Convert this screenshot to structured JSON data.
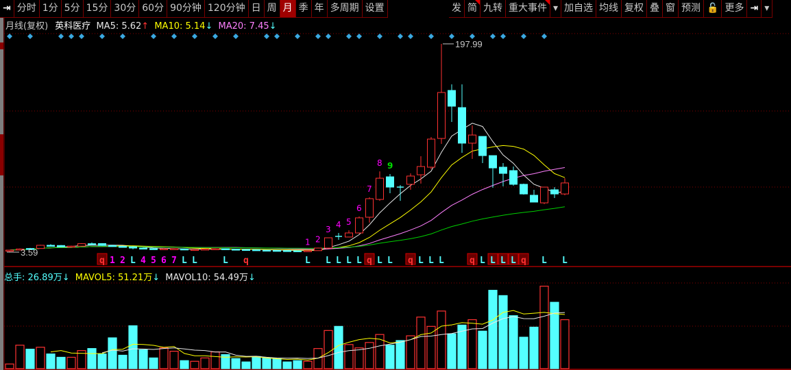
{
  "toolbar_left": [
    {
      "icon": "skip-to-end-icon",
      "label": "⇥"
    },
    {
      "label": "分时"
    },
    {
      "label": "1分"
    },
    {
      "label": "5分"
    },
    {
      "label": "15分"
    },
    {
      "label": "30分"
    },
    {
      "label": "60分"
    },
    {
      "label": "90分钟"
    },
    {
      "label": "120分钟"
    },
    {
      "label": "日"
    },
    {
      "label": "周"
    },
    {
      "label": "月",
      "active": true
    },
    {
      "label": "季"
    },
    {
      "label": "年"
    },
    {
      "label": "多周期"
    },
    {
      "label": "设置"
    }
  ],
  "toolbar_right": [
    {
      "label": "发"
    },
    {
      "label": "简",
      "flag": true
    },
    {
      "label": "九转"
    },
    {
      "label": "重大事件",
      "flag": true
    },
    {
      "icon": "dropdown-icon",
      "label": "▾"
    },
    {
      "label": "加自选"
    },
    {
      "label": "均线"
    },
    {
      "label": "复权"
    },
    {
      "label": "叠"
    },
    {
      "label": "窗"
    },
    {
      "label": "预测"
    },
    {
      "icon": "lock-icon",
      "label": "🔓"
    },
    {
      "label": "更多"
    },
    {
      "icon": "skip-to-end-icon",
      "label": "⇥"
    },
    {
      "icon": "dropdown-icon",
      "label": "▾"
    }
  ],
  "info": {
    "period": "月线(复权)",
    "stock_name": "英科医疗",
    "ma5_label": "MA5: 5.62",
    "ma5_arrow": "↑",
    "ma10_label": "MA10: 5.14",
    "ma10_arrow": "↓",
    "ma20_label": "MA20: 7.45",
    "ma20_arrow": "↓"
  },
  "volume_info": {
    "total_label": "总手: 26.89万",
    "total_arrow": "↓",
    "mavol5_label": "MAVOL5: 51.21万",
    "mavol5_arrow": "↓",
    "mavol10_label": "MAVOL10: 54.49万",
    "mavol10_arrow": "↓"
  },
  "colors": {
    "up": "#ff3232",
    "down": "#54ffff",
    "ma5": "#e8e8e8",
    "ma10": "#ffff00",
    "ma20": "#ff80ff",
    "ma40": "#00d000",
    "grid": "#8a0000",
    "td_num": "#ff00ff",
    "td_nine": "#00e000"
  },
  "chart_data": {
    "type": "candlestick",
    "period": "monthly",
    "ylim": [
      3.59,
      197.99
    ],
    "max_label": "197.99",
    "min_label": "3.59",
    "ohlc": [
      [
        4.5,
        5.8,
        3.59,
        5.5
      ],
      [
        5.5,
        7,
        5.2,
        6.5
      ],
      [
        7,
        7.5,
        6.2,
        6.6
      ],
      [
        7,
        10.5,
        6.8,
        10
      ],
      [
        10,
        11,
        9.2,
        9.8
      ],
      [
        9.8,
        10.2,
        8.3,
        8.6
      ],
      [
        8.6,
        9.6,
        8.3,
        9.2
      ],
      [
        9.2,
        12,
        9,
        11.5
      ],
      [
        11.5,
        12.6,
        10.6,
        11
      ],
      [
        11.6,
        12,
        9.5,
        9.8
      ],
      [
        9.8,
        10.2,
        8.6,
        9
      ],
      [
        9,
        9.4,
        8.2,
        8.6
      ],
      [
        8.6,
        9,
        6.2,
        7.4
      ],
      [
        7.4,
        8,
        6.5,
        6.9
      ],
      [
        6.9,
        7.5,
        5.9,
        6.3
      ],
      [
        6.3,
        7.6,
        6,
        6.8
      ],
      [
        6.4,
        7.2,
        6.1,
        6.9
      ],
      [
        6.6,
        6.9,
        5.6,
        5.9
      ],
      [
        5.6,
        6.4,
        5.1,
        6.1
      ],
      [
        6,
        6.8,
        5.8,
        6.5
      ],
      [
        6.3,
        7.2,
        6,
        6.8
      ],
      [
        6.8,
        7,
        6.1,
        6.4
      ],
      [
        6.4,
        6.8,
        5.9,
        6.1
      ],
      [
        6.1,
        6.4,
        5.7,
        5.9
      ],
      [
        5.9,
        6.2,
        5.3,
        5.5
      ],
      [
        5.5,
        5.8,
        5,
        5.3
      ],
      [
        5.3,
        5.6,
        4.9,
        5.1
      ],
      [
        5.1,
        5.3,
        4.7,
        4.9
      ],
      [
        4.9,
        5.1,
        4.5,
        4.8
      ],
      [
        4.8,
        5.3,
        4.6,
        5
      ],
      [
        5,
        7.8,
        4.9,
        7.4
      ],
      [
        7.4,
        17,
        7.2,
        17
      ],
      [
        18.3,
        21.5,
        15.1,
        18.3
      ],
      [
        17.7,
        24,
        17.7,
        21.5
      ],
      [
        21.5,
        36.9,
        20.9,
        35.6
      ],
      [
        36.2,
        54.8,
        31.1,
        53.5
      ],
      [
        52.8,
        79,
        51.5,
        72.6
      ],
      [
        73.9,
        76.5,
        58.6,
        64.3
      ],
      [
        64.3,
        66.2,
        51.5,
        64.3
      ],
      [
        66.9,
        77.1,
        61.8,
        74.6
      ],
      [
        75.8,
        93.1,
        67.5,
        83.5
      ],
      [
        82.9,
        111,
        81,
        109.1
      ],
      [
        109.7,
        197.99,
        104.6,
        152.6
      ],
      [
        154.5,
        160.2,
        125.1,
        139.8
      ],
      [
        138.5,
        160.2,
        96.3,
        105.3
      ],
      [
        105.3,
        121.9,
        90.6,
        112.9
      ],
      [
        111.6,
        111.6,
        86.7,
        93.7
      ],
      [
        93.7,
        93.7,
        63.7,
        82.2
      ],
      [
        82.9,
        86.7,
        65,
        77.1
      ],
      [
        79.7,
        83.5,
        65.6,
        66.9
      ],
      [
        66.9,
        67.5,
        57.3,
        57.9
      ],
      [
        56.7,
        61.8,
        50.3,
        50.3
      ],
      [
        49.6,
        64.3,
        48.4,
        64.3
      ],
      [
        61.8,
        64.3,
        54.1,
        57.9
      ],
      [
        57.9,
        72.6,
        56.7,
        68.2
      ]
    ],
    "volume_unit": "万",
    "volume": [
      4.3,
      21.7,
      18,
      19.8,
      13.6,
      10.5,
      10.5,
      16.7,
      18.6,
      13.6,
      28.5,
      12.4,
      39.7,
      17.4,
      9.9,
      19.2,
      16.1,
      7.4,
      6.8,
      9.9,
      15.5,
      13,
      9.3,
      6.2,
      11.2,
      9.9,
      9.3,
      6.2,
      7.4,
      6.8,
      18.6,
      35.3,
      39.1,
      22.3,
      19.2,
      24.2,
      31.6,
      21.7,
      26,
      30.4,
      47.7,
      39.1,
      53.3,
      32.2,
      40.3,
      45.3,
      34.7,
      72.5,
      67.6,
      49,
      29.1,
      38.4,
      76.3,
      61.4,
      45.3
    ],
    "volume_ylim": [
      0,
      78
    ],
    "diamond_markers": [
      0,
      2,
      5,
      6,
      7,
      9,
      11,
      14,
      16,
      18,
      20,
      22,
      25,
      26,
      28,
      30,
      31,
      33,
      34,
      36,
      38,
      39,
      41,
      43,
      45,
      47,
      48,
      50,
      52
    ],
    "td_sequence": [
      {
        "i": 29,
        "n": "1"
      },
      {
        "i": 30,
        "n": "2"
      },
      {
        "i": 31,
        "n": "3"
      },
      {
        "i": 32,
        "n": "4"
      },
      {
        "i": 33,
        "n": "5"
      },
      {
        "i": 34,
        "n": "6"
      },
      {
        "i": 35,
        "n": "7"
      },
      {
        "i": 36,
        "n": "8"
      },
      {
        "i": 37,
        "n": "9"
      }
    ],
    "bottom_signals": [
      {
        "i": 9,
        "t": "q",
        "box": true
      },
      {
        "i": 10,
        "t": "1",
        "c": "num"
      },
      {
        "i": 11,
        "t": "2",
        "c": "num"
      },
      {
        "i": 12,
        "t": "L"
      },
      {
        "i": 13,
        "t": "4",
        "c": "num"
      },
      {
        "i": 14,
        "t": "5",
        "c": "num"
      },
      {
        "i": 15,
        "t": "6",
        "c": "num"
      },
      {
        "i": 16,
        "t": "7",
        "c": "num"
      },
      {
        "i": 17,
        "t": "L"
      },
      {
        "i": 18,
        "t": "L"
      },
      {
        "i": 21,
        "t": "L"
      },
      {
        "i": 23,
        "t": "q"
      },
      {
        "i": 29,
        "t": "L"
      },
      {
        "i": 31,
        "t": "L"
      },
      {
        "i": 32,
        "t": "L"
      },
      {
        "i": 33,
        "t": "L"
      },
      {
        "i": 34,
        "t": "L"
      },
      {
        "i": 35,
        "t": "q",
        "box": true
      },
      {
        "i": 36,
        "t": "L"
      },
      {
        "i": 37,
        "t": "L"
      },
      {
        "i": 39,
        "t": "q",
        "box": true
      },
      {
        "i": 40,
        "t": "L"
      },
      {
        "i": 41,
        "t": "L"
      },
      {
        "i": 42,
        "t": "L"
      },
      {
        "i": 45,
        "t": "q",
        "box": true
      },
      {
        "i": 46,
        "t": "L"
      },
      {
        "i": 47,
        "t": "L",
        "box": true
      },
      {
        "i": 48,
        "t": "L",
        "box": true
      },
      {
        "i": 49,
        "t": "L",
        "box": true
      },
      {
        "i": 50,
        "t": "q",
        "box": true
      },
      {
        "i": 52,
        "t": "L"
      },
      {
        "i": 54,
        "t": "L"
      }
    ],
    "ma_periods": [
      5,
      10,
      20,
      40
    ],
    "mavol_periods": [
      5,
      10
    ]
  }
}
